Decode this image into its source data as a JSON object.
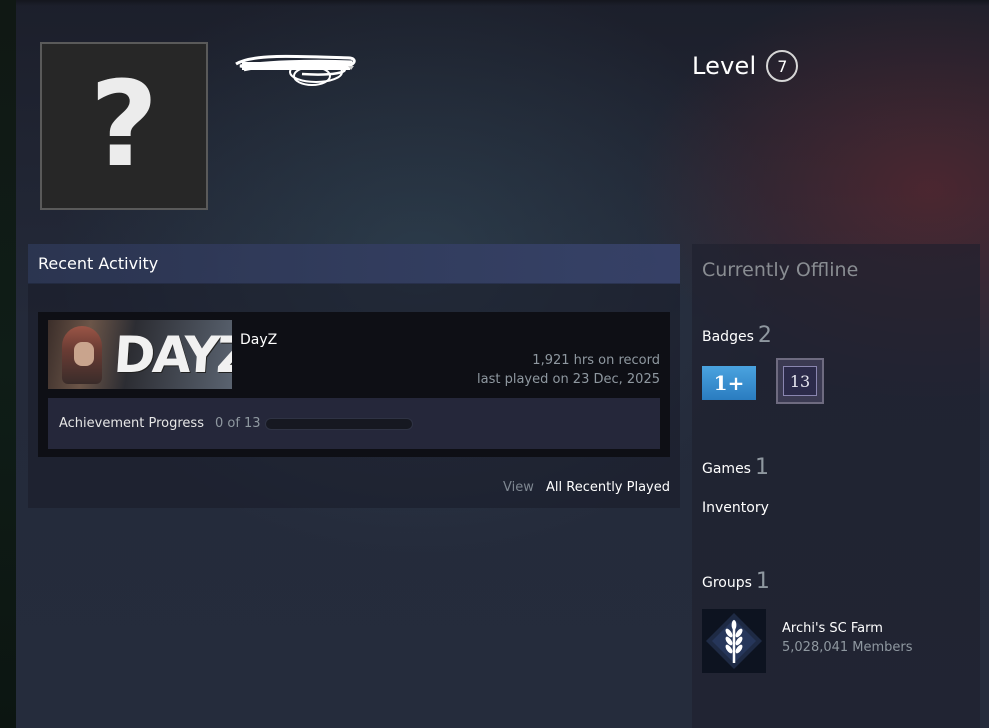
{
  "profile": {
    "avatar_placeholder": "?",
    "level_label": "Level",
    "level_value": "7"
  },
  "recent_activity": {
    "header": "Recent Activity",
    "game": {
      "title": "DayZ",
      "capsule_logo": "DAYZ",
      "hours": "1,921 hrs on record",
      "last_played": "last played on 23 Dec, 2025",
      "achievement_label": "Achievement Progress",
      "achievement_count": "0 of 13",
      "achievement_fraction": 0
    },
    "view_label": "View",
    "view_link": "All Recently Played"
  },
  "sidebar": {
    "status": "Currently Offline",
    "badges_label": "Badges",
    "badges_count": "2",
    "badge_items": [
      "1+",
      "13"
    ],
    "games_label": "Games",
    "games_count": "1",
    "inventory_label": "Inventory",
    "groups_label": "Groups",
    "groups_count": "1",
    "group": {
      "name": "Archi's SC Farm",
      "members": "5,028,041 Members"
    }
  },
  "colors": {
    "accent_blue": "#4aa3df",
    "muted_text": "#8f98a0",
    "header_gradient": "#3a4670"
  }
}
